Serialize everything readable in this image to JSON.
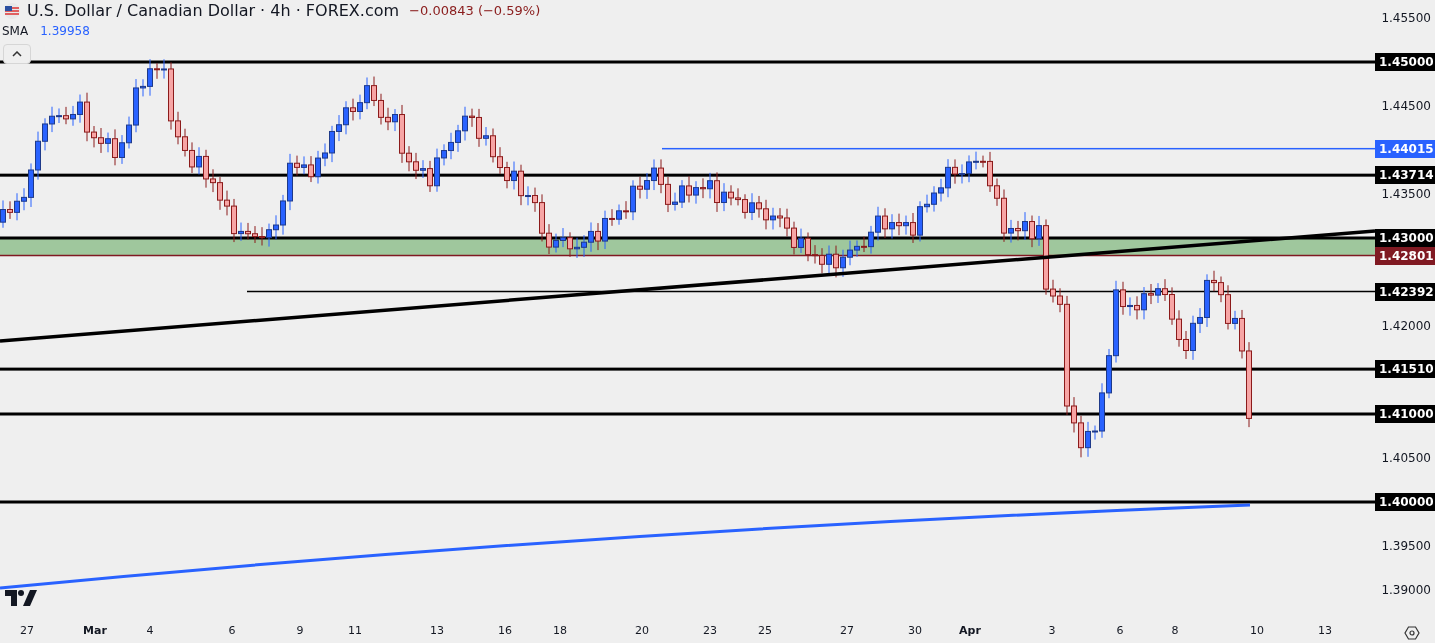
{
  "header": {
    "title": "U.S. Dollar / Canadian Dollar · 4h · FOREX.com",
    "change": "−0.00843 (−0.59%)"
  },
  "indicator": {
    "name": "SMA",
    "value": "1.39958"
  },
  "price_axis": [
    {
      "label": "1.45500",
      "kind": "tick"
    },
    {
      "label": "1.45000",
      "kind": "level",
      "color": "#000000"
    },
    {
      "label": "1.44500",
      "kind": "tick"
    },
    {
      "label": "1.44015",
      "kind": "marker",
      "color": "#2962ff"
    },
    {
      "label": "1.43714",
      "kind": "level",
      "color": "#000000"
    },
    {
      "label": "1.43500",
      "kind": "tick"
    },
    {
      "label": "1.43000",
      "kind": "level",
      "color": "#000000"
    },
    {
      "label": "1.42801",
      "kind": "marker",
      "color": "#801922"
    },
    {
      "label": "1.42392",
      "kind": "marker",
      "color": "#000000"
    },
    {
      "label": "1.42000",
      "kind": "tick"
    },
    {
      "label": "1.41510",
      "kind": "level",
      "color": "#000000"
    },
    {
      "label": "1.41000",
      "kind": "level",
      "color": "#000000"
    },
    {
      "label": "1.40500",
      "kind": "tick"
    },
    {
      "label": "1.40000",
      "kind": "level",
      "color": "#000000"
    },
    {
      "label": "1.39500",
      "kind": "tick"
    },
    {
      "label": "1.39000",
      "kind": "tick"
    }
  ],
  "time_axis": [
    {
      "label": "27",
      "kind": "day"
    },
    {
      "label": "Mar",
      "kind": "month"
    },
    {
      "label": "4",
      "kind": "day"
    },
    {
      "label": "6",
      "kind": "day"
    },
    {
      "label": "9",
      "kind": "day"
    },
    {
      "label": "11",
      "kind": "day"
    },
    {
      "label": "13",
      "kind": "day"
    },
    {
      "label": "16",
      "kind": "day"
    },
    {
      "label": "18",
      "kind": "day"
    },
    {
      "label": "20",
      "kind": "day"
    },
    {
      "label": "23",
      "kind": "day"
    },
    {
      "label": "25",
      "kind": "day"
    },
    {
      "label": "27",
      "kind": "day"
    },
    {
      "label": "30",
      "kind": "day"
    },
    {
      "label": "Apr",
      "kind": "month"
    },
    {
      "label": "3",
      "kind": "day"
    },
    {
      "label": "6",
      "kind": "day"
    },
    {
      "label": "8",
      "kind": "day"
    },
    {
      "label": "10",
      "kind": "day"
    },
    {
      "label": "13",
      "kind": "day"
    }
  ]
}
